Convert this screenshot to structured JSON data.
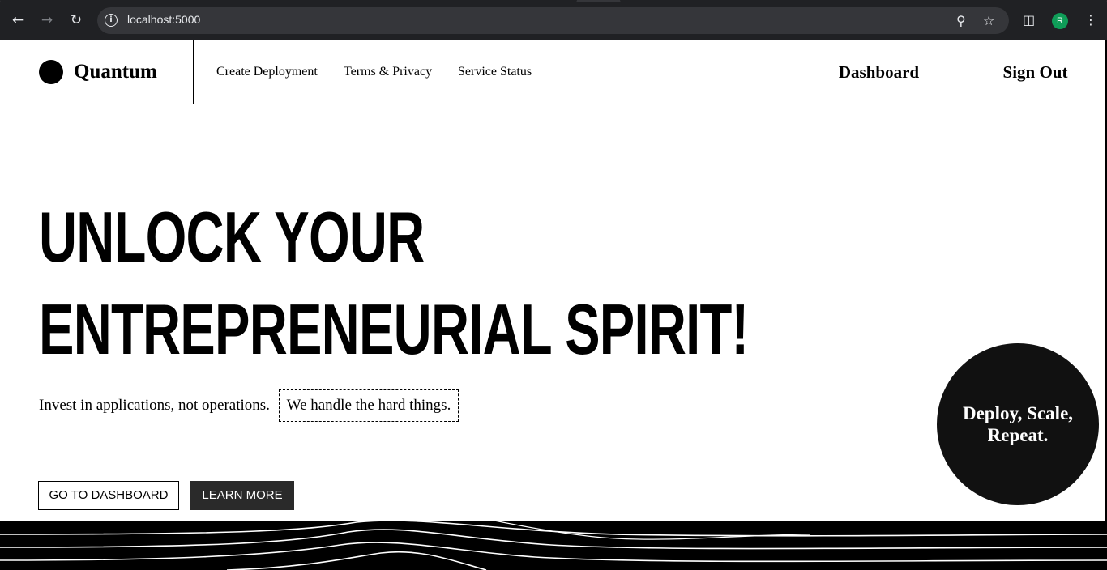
{
  "browser": {
    "url": "localhost:5000",
    "profile_initial": "R",
    "nav_icons": [
      "back-icon",
      "forward-icon",
      "reload-icon"
    ],
    "omnibox_icons": [
      "site-info-icon",
      "zoom-icon",
      "bookmark-star-icon"
    ],
    "toolbar_icons": [
      "side-panel-icon",
      "profile-avatar",
      "menu-kebab-icon"
    ]
  },
  "site": {
    "brand": "Quantum",
    "nav": [
      "Create Deployment",
      "Terms & Privacy",
      "Service Status"
    ],
    "dashboard_label": "Dashboard",
    "signout_label": "Sign Out"
  },
  "hero": {
    "title_line1": "UNLOCK YOUR",
    "title_line2": "ENTREPRENEURIAL SPIRIT!",
    "subtitle": "Invest in applications, not operations.",
    "highlight": "We handle the hard things.",
    "primary_button": "GO TO DASHBOARD",
    "secondary_button": "LEARN MORE",
    "badge": "Deploy, Scale, Repeat."
  },
  "colors": {
    "chrome_bg": "#202124",
    "omnibox_bg": "#35363a",
    "ink": "#000000",
    "badge_bg": "#111111",
    "solid_button_bg": "#2a2a2a",
    "avatar_bg": "#0f9d58"
  }
}
